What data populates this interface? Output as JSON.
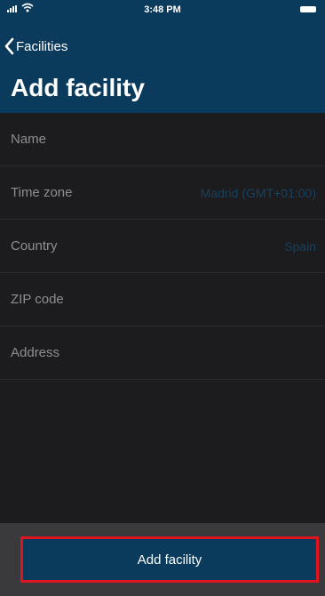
{
  "status_bar": {
    "time": "3:48 PM"
  },
  "nav": {
    "back_label": "Facilities",
    "title": "Add facility"
  },
  "form": {
    "fields": [
      {
        "label": "Name",
        "value": ""
      },
      {
        "label": "Time zone",
        "value": "Madrid (GMT+01:00)"
      },
      {
        "label": "Country",
        "value": "Spain"
      },
      {
        "label": "ZIP code",
        "value": ""
      },
      {
        "label": "Address",
        "value": ""
      }
    ]
  },
  "footer": {
    "button_label": "Add facility"
  },
  "colors": {
    "header_bg": "#0b3b5c",
    "screen_bg": "#1c1c1e",
    "field_value": "#16415f",
    "highlight_border": "#e0141e"
  }
}
